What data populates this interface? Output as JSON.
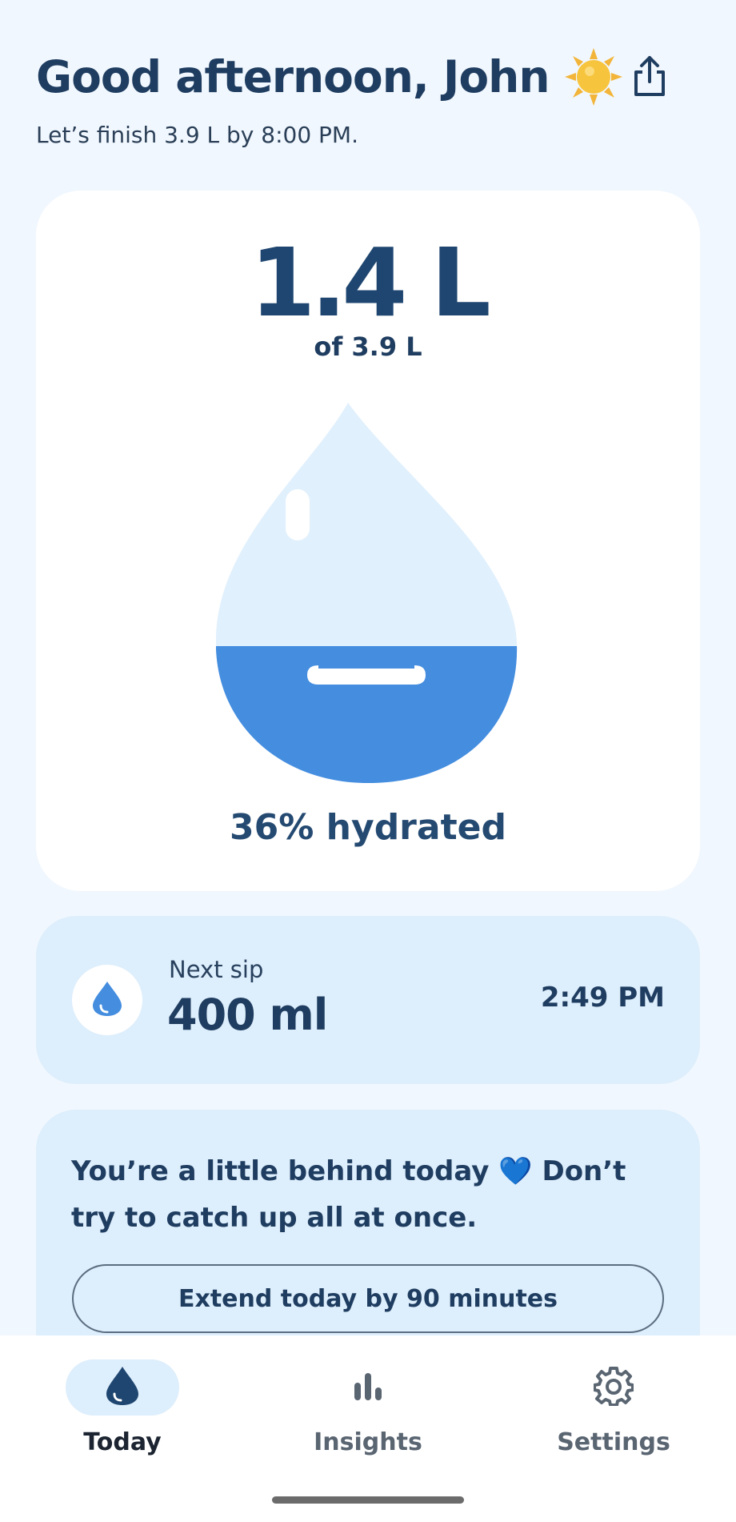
{
  "header": {
    "greeting": "Good afternoon, John",
    "greeting_icon": "sun-icon",
    "subtitle": "Let’s finish 3.9 L by 8:00 PM.",
    "share_icon": "share-icon"
  },
  "progress": {
    "amount": "1.4 L",
    "of_goal": "of 3.9 L",
    "fill_fraction": 0.36,
    "hydrated_label": "36% hydrated"
  },
  "next_sip": {
    "label": "Next sip",
    "amount": "400 ml",
    "time": "2:49 PM",
    "icon": "water-drop-icon"
  },
  "tip": {
    "text": "You’re a little behind today",
    "heart": "💙",
    "text2": "Don’t try to catch up all at once.",
    "button_label": "Extend today by 90 minutes"
  },
  "nav": {
    "items": [
      {
        "label": "Today",
        "icon": "water-drop-icon",
        "active": true
      },
      {
        "label": "Insights",
        "icon": "bar-chart-icon",
        "active": false
      },
      {
        "label": "Settings",
        "icon": "gear-icon",
        "active": false
      }
    ]
  },
  "colors": {
    "background": "#f1f7fe",
    "water": "#448ddf",
    "drop_light": "#e0f0fd",
    "text_dark": "#1f3d60"
  }
}
